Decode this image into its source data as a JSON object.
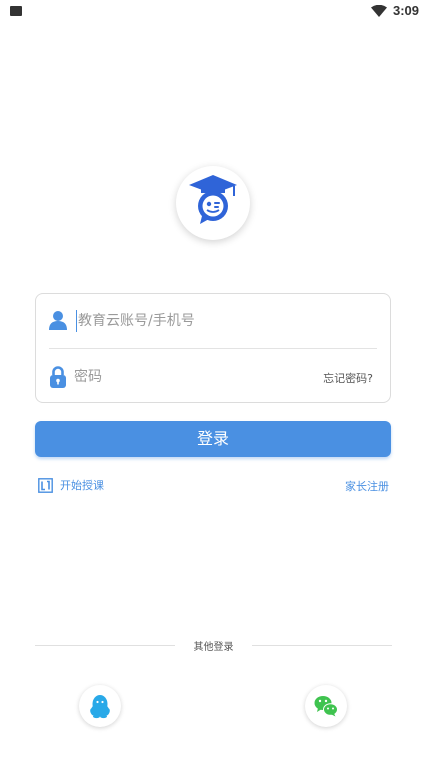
{
  "status_bar": {
    "time": "3:09"
  },
  "login_form": {
    "account_placeholder": "教育云账号/手机号",
    "password_placeholder": "密码",
    "forgot_password": "忘记密码?"
  },
  "login_button": "登录",
  "links": {
    "start_teaching": "开始授课",
    "parent_register": "家长注册"
  },
  "other_login": {
    "label": "其他登录",
    "providers": [
      "qq-icon",
      "wechat-icon"
    ]
  },
  "colors": {
    "accent": "#4a90e2",
    "qq": "#29a9e8",
    "wechat": "#3fc34f"
  }
}
